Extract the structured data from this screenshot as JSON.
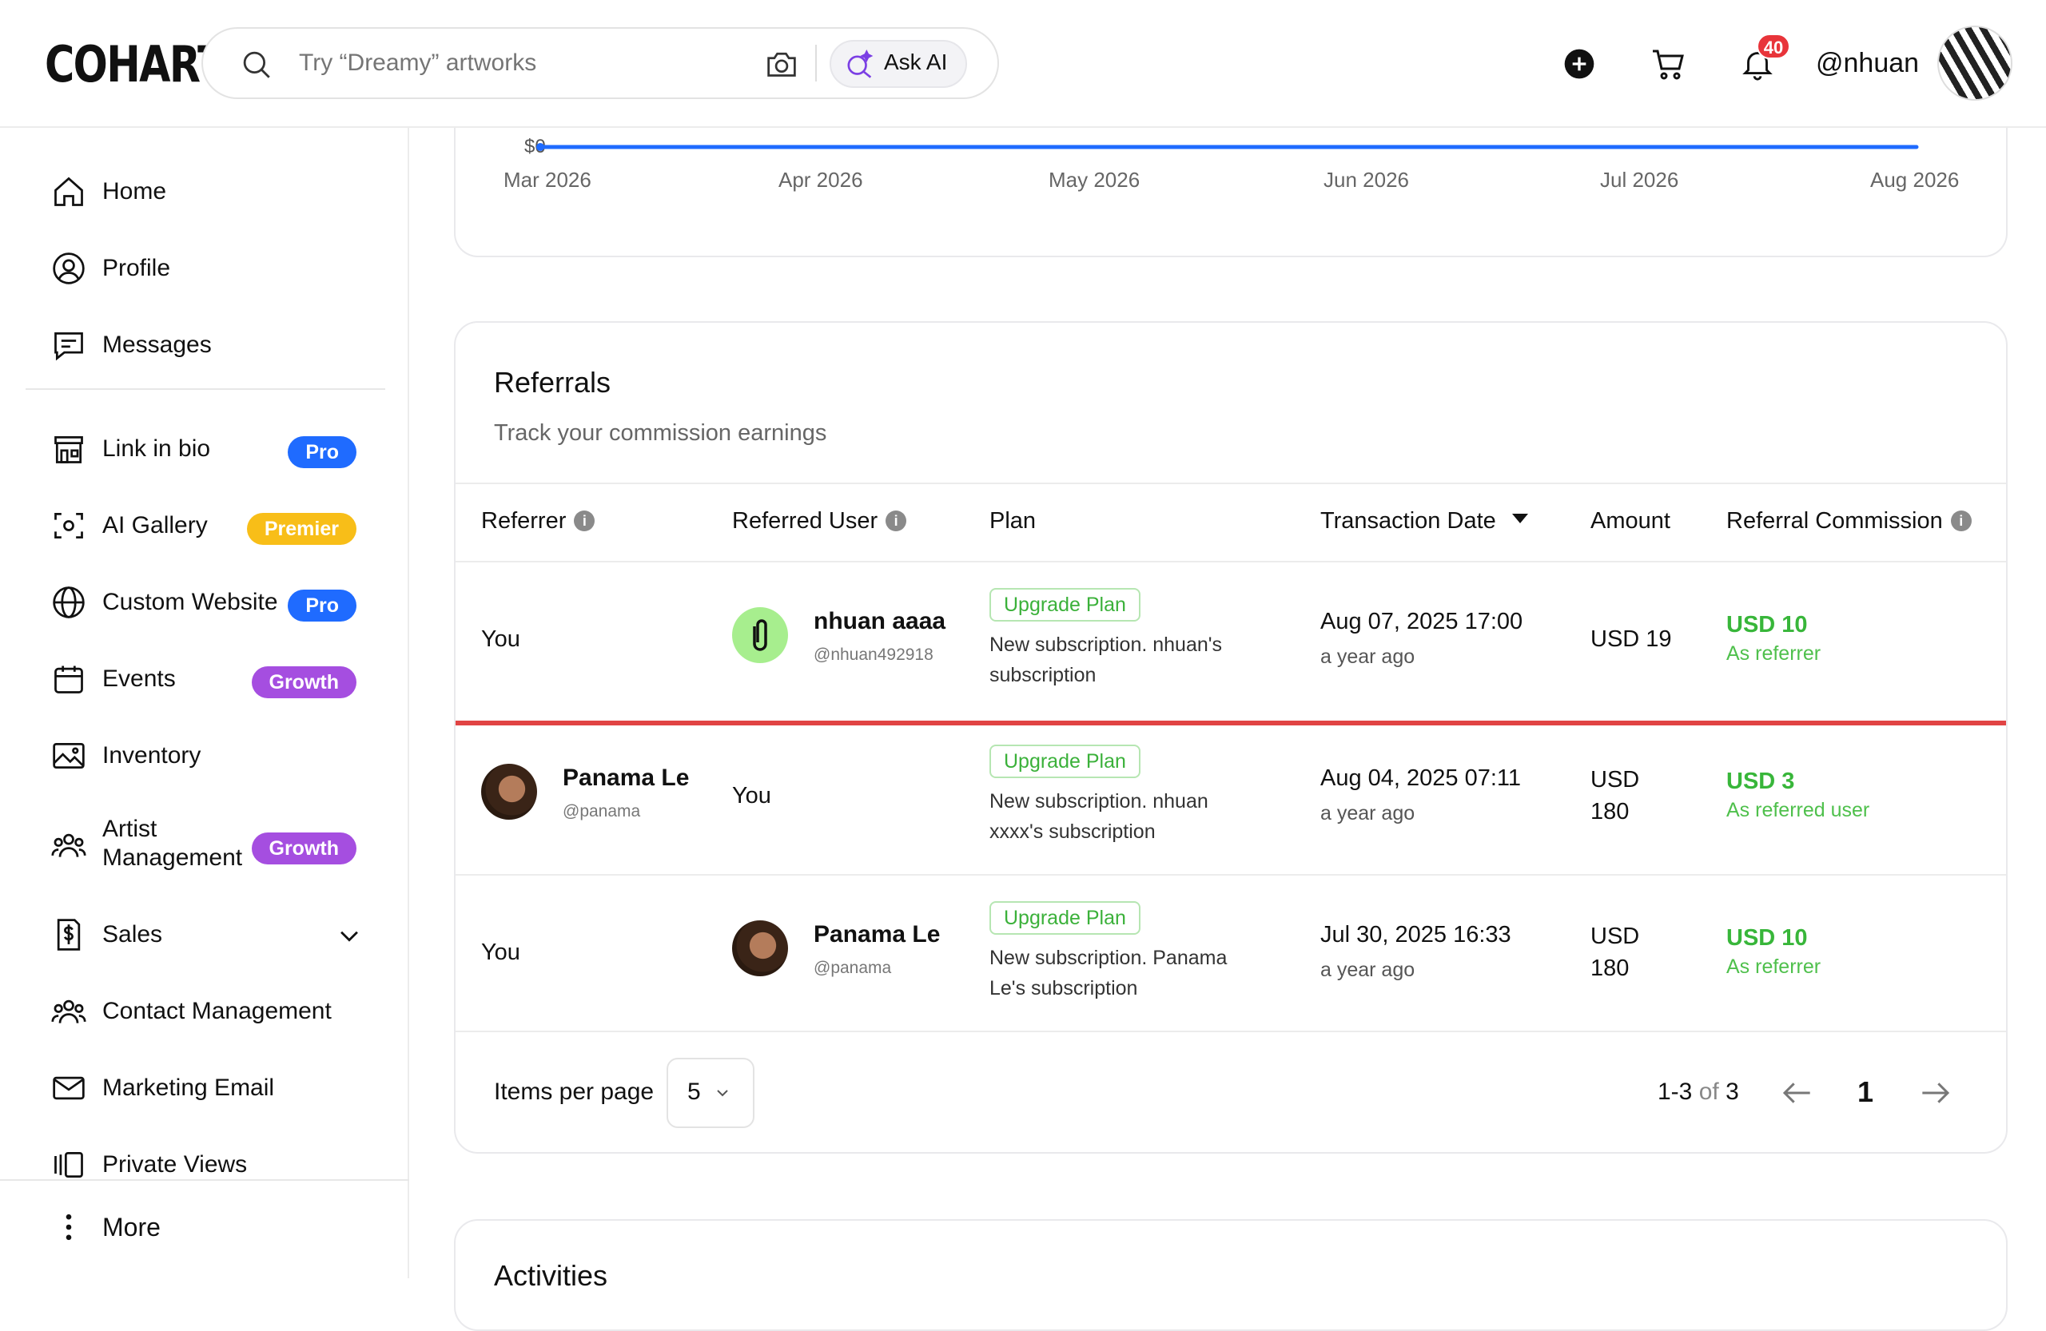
{
  "header": {
    "logo": "COHART",
    "search_placeholder": "Try “Dreamy” artworks",
    "ask_ai_label": "Ask AI",
    "notification_count": "40",
    "username": "@nhuan"
  },
  "sidebar": {
    "items": [
      {
        "label": "Home",
        "icon": "home-icon"
      },
      {
        "label": "Profile",
        "icon": "user-circle-icon"
      },
      {
        "label": "Messages",
        "icon": "message-icon"
      },
      {
        "label": "Link in bio",
        "icon": "storefront-icon",
        "tag": "Pro"
      },
      {
        "label": "AI Gallery",
        "icon": "scan-face-icon",
        "tag": "Premier"
      },
      {
        "label": "Custom Website",
        "icon": "globe-icon",
        "tag": "Pro"
      },
      {
        "label": "Events",
        "icon": "calendar-icon",
        "tag": "Growth"
      },
      {
        "label": "Inventory",
        "icon": "image-icon"
      },
      {
        "label": "Artist Management",
        "icon": "users-icon",
        "tag": "Growth"
      },
      {
        "label": "Sales",
        "icon": "dollar-doc-icon"
      },
      {
        "label": "Contact Management",
        "icon": "contacts-icon"
      },
      {
        "label": "Marketing Email",
        "icon": "mail-icon"
      },
      {
        "label": "Private Views",
        "icon": "gallery-stack-icon"
      }
    ],
    "more_label": "More"
  },
  "chart": {
    "y_tick": "$0",
    "x_ticks": [
      "Mar 2026",
      "Apr 2026",
      "May 2026",
      "Jun 2026",
      "Jul 2026",
      "Aug 2026"
    ]
  },
  "referrals": {
    "title": "Referrals",
    "subtitle": "Track your commission earnings",
    "columns": [
      "Referrer",
      "Referred User",
      "Plan",
      "Transaction Date",
      "Amount",
      "Referral Commission"
    ],
    "rows": [
      {
        "referrer": "You",
        "referred_name": "nhuan aaaa",
        "referred_handle": "@nhuan492918",
        "plan_tag": "Upgrade Plan",
        "plan_desc": "New subscription. nhuan's subscription",
        "date": "Aug 07, 2025 17:00",
        "date_rel": "a year ago",
        "amount": "USD 19",
        "commission": "USD 10",
        "commission_role": "As referrer"
      },
      {
        "referrer_name": "Panama Le",
        "referrer_handle": "@panama",
        "referred": "You",
        "plan_tag": "Upgrade Plan",
        "plan_desc": "New subscription. nhuan xxxx's subscription",
        "date": "Aug 04, 2025 07:11",
        "date_rel": "a year ago",
        "amount": "USD 180",
        "commission": "USD 3",
        "commission_role": "As referred user"
      },
      {
        "referrer": "You",
        "referred_name": "Panama Le",
        "referred_handle": "@panama",
        "plan_tag": "Upgrade Plan",
        "plan_desc": "New subscription. Panama Le's subscription",
        "date": "Jul 30, 2025 16:33",
        "date_rel": "a year ago",
        "amount": "USD 180",
        "commission": "USD 10",
        "commission_role": "As referrer"
      }
    ],
    "pagination": {
      "items_per_page_label": "Items per page",
      "items_per_page": "5",
      "range": "1-3",
      "of_label": "of",
      "total": "3",
      "current_page": "1"
    }
  },
  "activities": {
    "title": "Activities"
  },
  "colors": {
    "accent_blue": "#1f6bff",
    "premier": "#f8be18",
    "growth": "#a54ee0",
    "commission_green": "#38b63a",
    "line_blue": "#1f6bff"
  }
}
